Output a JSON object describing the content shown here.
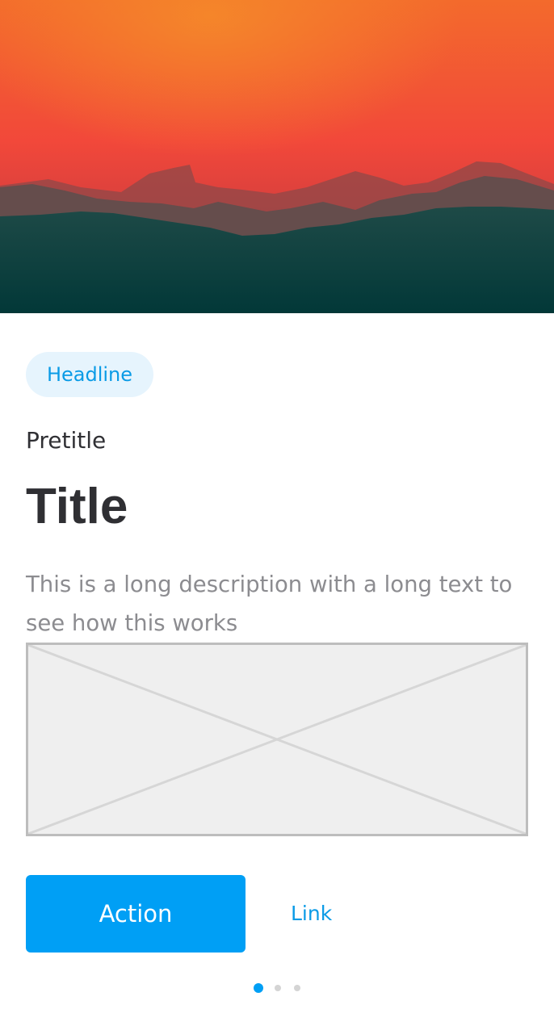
{
  "hero": {
    "image": "sunset-mountains-image"
  },
  "card": {
    "headline_chip": "Headline",
    "pretitle": "Pretitle",
    "title": "Title",
    "description": "This is a long description with a long text to see how this works",
    "placeholder": "image-placeholder-icon"
  },
  "actions": {
    "primary_label": "Action",
    "link_label": "Link"
  },
  "pagination": {
    "count": 3,
    "active_index": 0
  },
  "colors": {
    "accent": "#009ff5",
    "chip_background": "#e6f4fd",
    "chip_text": "#0a9be6",
    "title_text": "#2f2f33",
    "description_text": "#8c8c90",
    "dot_inactive": "#d4d4d4",
    "hero_sky_top": "#f26030",
    "hero_ground": "#023a3a"
  }
}
